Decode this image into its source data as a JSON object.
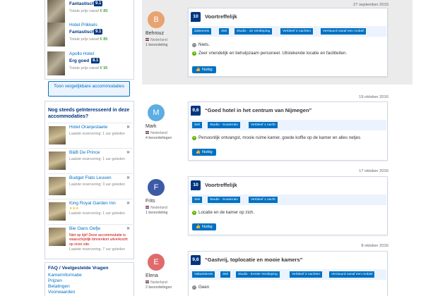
{
  "sidebar": {
    "top_hotels": [
      {
        "name": "",
        "score_label": "Fantastisch",
        "score": "9.1",
        "price": "Totale prijs vanaf € 89"
      },
      {
        "name": "Hotel Prikkels",
        "score_label": "Fantastisch",
        "score": "9.1",
        "price": "Totale prijs vanaf € 85"
      },
      {
        "name": "Apollo Hotel",
        "score_label": "Erg goed",
        "score": "8.1",
        "price": "Totale prijs vanaf € 95"
      }
    ],
    "compare_button": "Toon vergelijkbare accommodaties",
    "interest_heading": "Nog steeds geïnteresseerd in deze accommodaties?",
    "interest_items": [
      {
        "name": "Hotel Oranjestaete",
        "sub": "Laatste reservering: 1 uur geleden",
        "stars": ""
      },
      {
        "name": "B&B De Prince",
        "sub": "Laatste reservering: 1 uur geleden",
        "stars": ""
      },
      {
        "name": "Budget Flats Leuven",
        "sub": "Laatste reservering: 3 uur geleden",
        "stars": ""
      },
      {
        "name": "King Royal Garden Inn",
        "sub": "Laatste reservering: 1 uur geleden",
        "stars": "★★★"
      },
      {
        "name": "Bie Oans Oefje",
        "sub": "Niet op tijd! Deze accommodatie is waarschijnlijk binnenkort uitverkocht op onze site.",
        "sub2": "Laatste reservering: 7 uur geleden",
        "stars": ""
      }
    ],
    "faq_heading": "FAQ / Veelgestelde Vragen",
    "faq_links": [
      "Kamerinformatie",
      "Prijzen",
      "Betalingen",
      "Voorwaarden"
    ]
  },
  "reviews": [
    {
      "date": "27 september 2015",
      "initial": "B",
      "avatar_color": "#e8a370",
      "name": "Behrouz",
      "country": "Nederland",
      "count": "1 beoordeling",
      "score": "10",
      "title": "Voortreffelijk",
      "tags": [
        "Zakenreis",
        "Stel",
        "Studio - 2e Verdieping",
        "Verbleef 2 nachten",
        "Verstuurd vanaf een mobiel"
      ],
      "negative": "Niets.",
      "positive": "Zeer vriendelijk en behulpzaam personeel. Uitstekende locatie en faciliteiten.",
      "like": "Nuttig"
    },
    {
      "date": "19 oktober 2016",
      "initial": "M",
      "avatar_color": "#5dade2",
      "name": "Mark",
      "country": "Nederland",
      "count": "4 beoordelingen",
      "score": "9,6",
      "title": "“Goed hotel in het centrum van Nijmegen”",
      "tags": [
        "Stel",
        "Studio - Souterrain",
        "Verbleef 1 nacht"
      ],
      "negative": "",
      "positive": "Persoonlijk ontvangst, mooie ruime kamer, goede koffie op de kamer en alles netjes",
      "like": "Nuttig"
    },
    {
      "date": "17 oktober 2016",
      "initial": "F",
      "avatar_color": "#3d5aa6",
      "name": "Frits",
      "country": "Nederland",
      "count": "1 beoordeling",
      "score": "10",
      "title": "Voortreffelijk",
      "tags": [
        "Stel",
        "Studio - Souterrain",
        "Verbleef 1 nacht"
      ],
      "negative": "",
      "positive": "Locatie en de kamer op zich.",
      "like": "Nuttig"
    },
    {
      "date": "8 oktober 2016",
      "initial": "E",
      "avatar_color": "#e06b6b",
      "name": "Elena",
      "country": "Nederland",
      "count": "2 beoordelingen",
      "score": "9,6",
      "title": "“Gastvrij, toplocatie en mooie kamers”",
      "tags": [
        "Vakantiereis",
        "Stel",
        "Studio - Eerste Verdieping",
        "Verbleef 2 nachten",
        "Verstuurd vanaf een mobiel"
      ],
      "negative": "Geen",
      "positive": "",
      "like": ""
    }
  ]
}
